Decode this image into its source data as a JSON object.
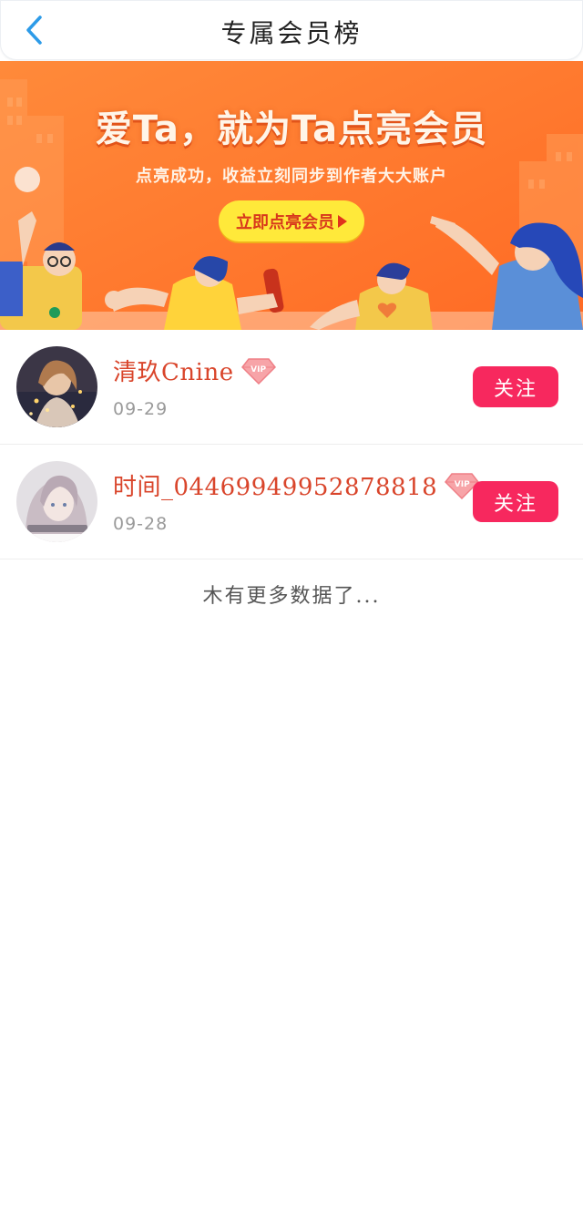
{
  "header": {
    "title": "专属会员榜",
    "back_icon": "chevron-left-icon"
  },
  "banner": {
    "headline": "爱Ta，就为Ta点亮会员",
    "subtitle": "点亮成功，收益立刻同步到作者大大账户",
    "cta_label": "立即点亮会员",
    "colors": {
      "background": "#ff7a2e",
      "cta": "#ffe93a"
    }
  },
  "members": [
    {
      "name": "清玖Cnine",
      "badge": "VIP",
      "date": "09-29",
      "follow_label": "关注"
    },
    {
      "name": "时间_0446994995287881​8",
      "badge": "VIP",
      "date": "09-28",
      "follow_label": "关注"
    }
  ],
  "footer_note": "木有更多数据了...",
  "colors": {
    "accent": "#f7285e",
    "username": "#d9452b",
    "back_icon": "#2d9be8"
  }
}
